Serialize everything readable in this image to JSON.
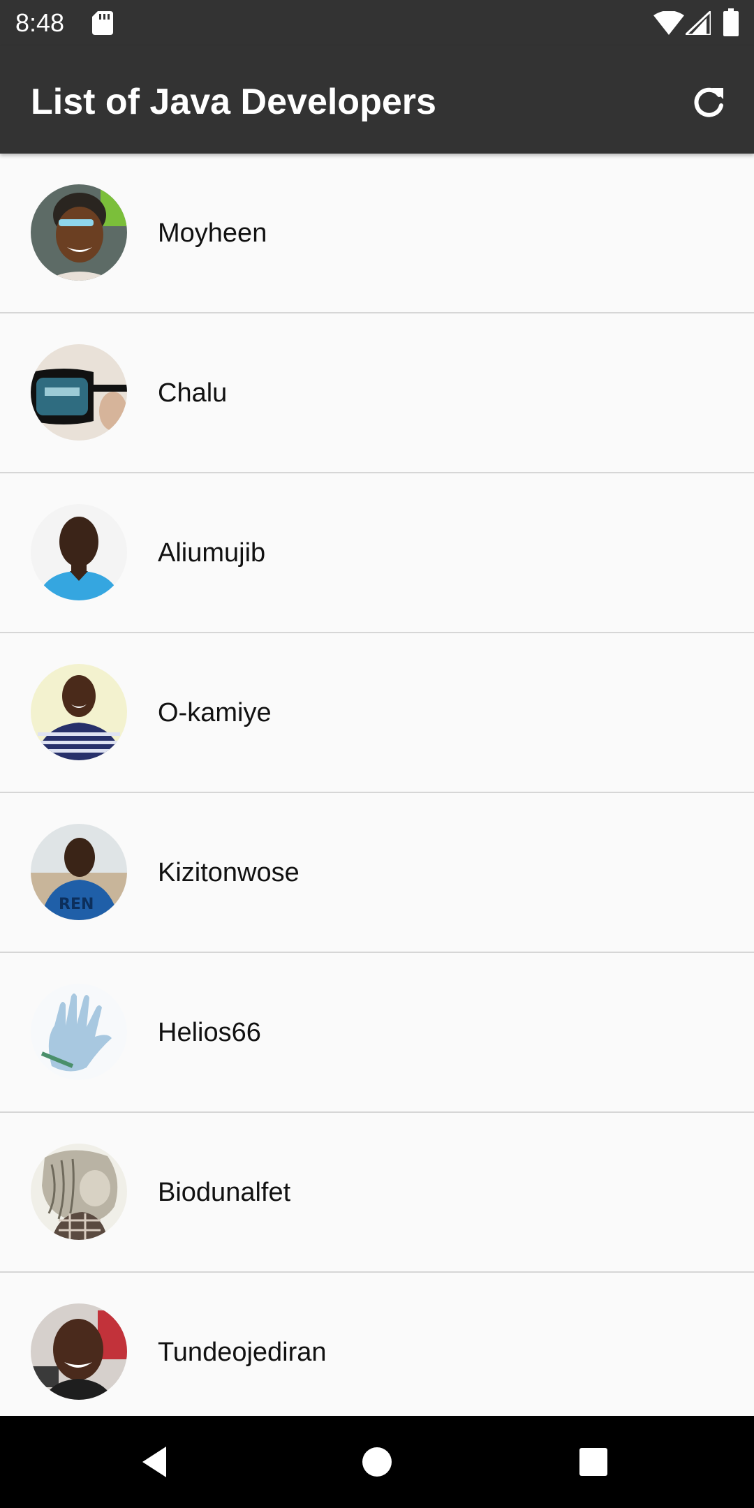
{
  "status_bar": {
    "time": "8:48",
    "icons": [
      "sd-card-icon",
      "wifi-icon",
      "signal-icon",
      "battery-icon"
    ]
  },
  "app_bar": {
    "title": "List of Java Developers",
    "action_icon": "refresh-icon",
    "background": "#333333"
  },
  "developers": [
    {
      "name": "Moyheen"
    },
    {
      "name": "Chalu"
    },
    {
      "name": "Aliumujib"
    },
    {
      "name": "O-kamiye"
    },
    {
      "name": "Kizitonwose"
    },
    {
      "name": "Helios66"
    },
    {
      "name": "Biodunalfet"
    },
    {
      "name": "Tundeojediran"
    }
  ],
  "nav_bar": {
    "icons": [
      "back-icon",
      "home-icon",
      "recents-icon"
    ]
  }
}
